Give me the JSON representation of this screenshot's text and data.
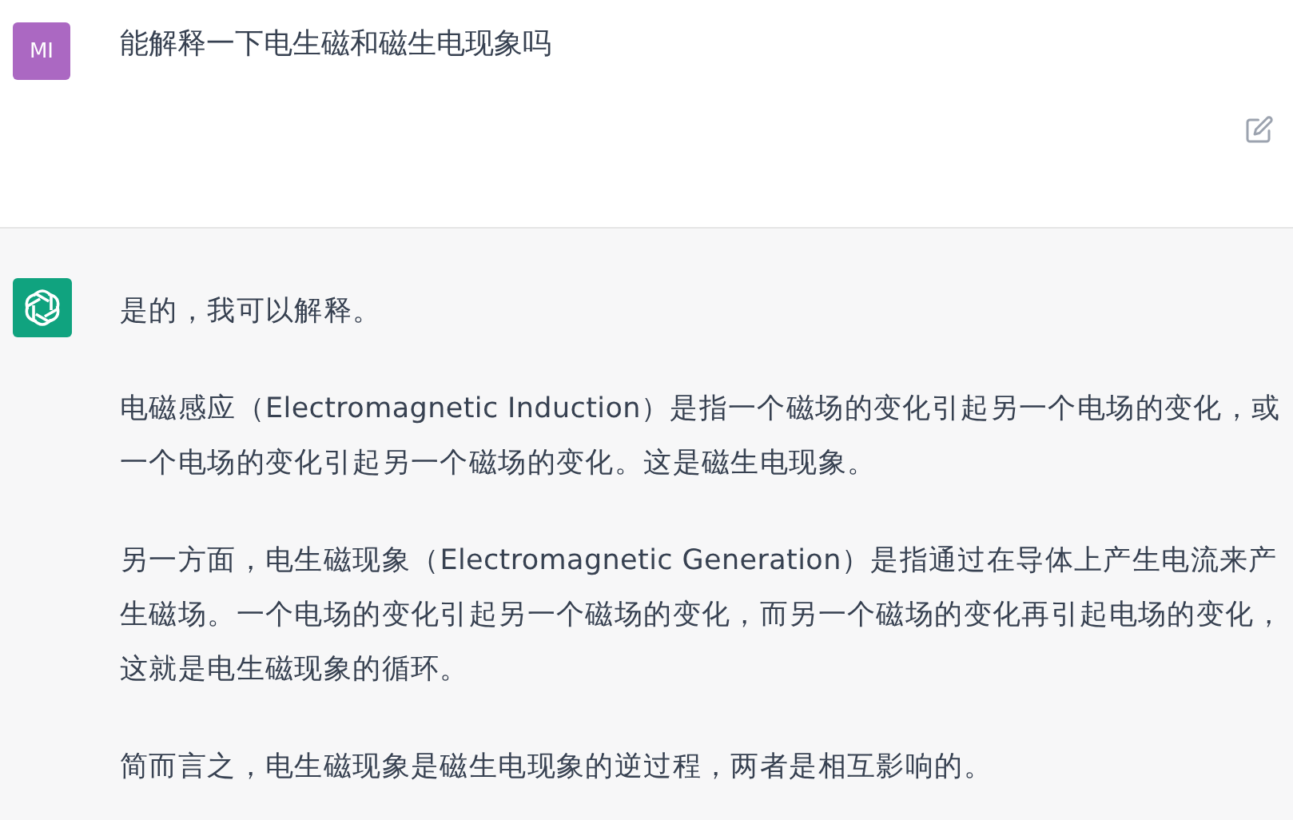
{
  "user_message": {
    "avatar": "MI",
    "text": "能解释一下电生磁和磁生电现象吗"
  },
  "assistant_message": {
    "paragraphs": [
      "是的，我可以解释。",
      "电磁感应（Electromagnetic Induction）是指一个磁场的变化引起另一个电场的变化，或一个电场的变化引起另一个磁场的变化。这是磁生电现象。",
      "另一方面，电生磁现象（Electromagnetic Generation）是指通过在导体上产生电流来产生磁场。一个电场的变化引起另一个磁场的变化，而另一个磁场的变化再引起电场的变化，这就是电生磁现象的循环。",
      "简而言之，电生磁现象是磁生电现象的逆过程，两者是相互影响的。"
    ]
  }
}
